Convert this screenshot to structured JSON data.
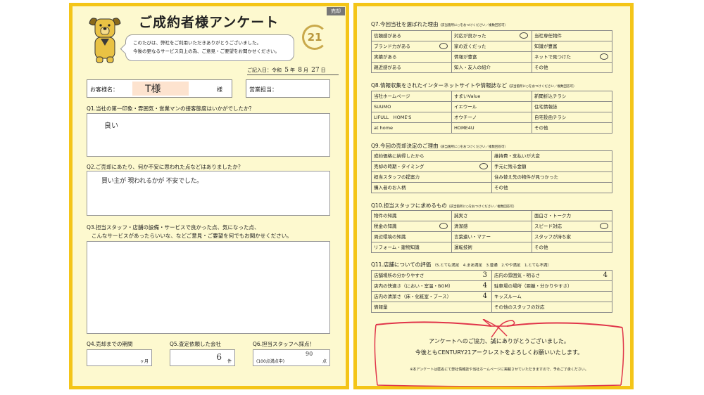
{
  "header": {
    "title": "ご成約者様アンケート",
    "intro_1": "このたびは、弊社をご利用いただきありがとうございました。",
    "intro_2": "今後の更なるサービス向上の為、ご意見・ご要望をお聞かせください。",
    "brand": "21",
    "tag": "売却"
  },
  "date": {
    "label": "ご記入日：令和",
    "year": "5",
    "month": "8",
    "day": "27",
    "y": "年",
    "m": "月",
    "d": "日"
  },
  "customer": {
    "label": "お客様名：",
    "name": "T様",
    "suffix": "様"
  },
  "staff": {
    "label": "営業担当："
  },
  "q1": {
    "label": "Q1.当社の第一印象・雰囲気・営業マンの接客態度はいかがでしたか？",
    "answer": "良い"
  },
  "q2": {
    "label": "Q2.ご売却にあたり、何か不安に思われた点などはありましたか？",
    "answer": "買い主が 現われるかが 不安でした。"
  },
  "q3": {
    "label_1": "Q3.担当スタッフ・店舗の設備・サービスで良かった点、気になった点、",
    "label_2": "こんなサービスがあったらいいな、などご意見・ご要望を何でもお聞かせください。",
    "answer": ""
  },
  "q4": {
    "label": "Q4.売却までの期間",
    "value": "",
    "unit": "ヶ月"
  },
  "q5": {
    "label": "Q5.査定依頼した会社",
    "value": "6",
    "unit": "件"
  },
  "q6": {
    "label": "Q6.担当スタッフへ採点！",
    "value": "90",
    "note": "(100点満点中)",
    "unit": "点"
  },
  "q7": {
    "label": "Q7.今回当社を選ばれた理由",
    "note": "（該当箇所に○をおつけください／複数回答可）",
    "rows": [
      [
        "信頼感がある",
        "対応が良かった",
        "当社専任物件"
      ],
      [
        "ブランド力がある",
        "家の近くだった",
        "知識が豊富"
      ],
      [
        "実績がある",
        "情報が豊富",
        "ネットで見つけた"
      ],
      [
        "親近感がある",
        "知人・友人の紹介",
        "その他"
      ]
    ],
    "marks": [
      [
        false,
        true,
        false
      ],
      [
        true,
        false,
        false
      ],
      [
        false,
        false,
        true
      ],
      [
        false,
        false,
        false
      ]
    ]
  },
  "q8": {
    "label": "Q8.情報収集をされたインターネットサイトや情報誌など",
    "note": "（該当箇所に○をおつけください／複数回答可）",
    "rows": [
      [
        "当社ホームページ",
        "すまいValue",
        "新聞折込チラシ"
      ],
      [
        "SUUMO",
        "イエウール",
        "住宅情報誌"
      ],
      [
        "LIFULL　HOME'S",
        "オウチーノ",
        "自宅投函チラシ"
      ],
      [
        "at home",
        "HOME4U",
        "その他"
      ]
    ]
  },
  "q9": {
    "label": "Q9.今回の売却決定のご理由",
    "note": "（該当箇所に○をおつけください／複数回答可）",
    "rows": [
      [
        "成約価格に納得したから",
        "維持費・支払いが大変"
      ],
      [
        "売却の時期・タイミング",
        "手元に残る金額"
      ],
      [
        "担当スタッフの提案力",
        "住み替え先の物件が見つかった"
      ],
      [
        "購入者のお人柄",
        "その他"
      ]
    ],
    "marks": [
      [
        false,
        false
      ],
      [
        true,
        false
      ],
      [
        false,
        false
      ],
      [
        false,
        false
      ]
    ]
  },
  "q10": {
    "label": "Q10.担当スタッフに求めるもの",
    "note": "（該当箇所に○をおつけください／複数回答可）",
    "rows": [
      [
        "物件の知識",
        "誠実さ",
        "面白さ・トーク力"
      ],
      [
        "税金の知識",
        "清潔感",
        "スピード対応"
      ],
      [
        "周辺環境の知識",
        "言葉遣い・マナー",
        "スタッフが持ち家"
      ],
      [
        "リフォーム・建物知識",
        "運転技術",
        "その他"
      ]
    ],
    "marks": [
      [
        false,
        false,
        false
      ],
      [
        true,
        false,
        true
      ],
      [
        false,
        false,
        false
      ],
      [
        false,
        false,
        false
      ]
    ]
  },
  "q11": {
    "label": "Q11.店舗についての評価",
    "scale": "（5.とても満足　4.まあ満足　3.普通　2.やや満足　1.とても不満）",
    "rows": [
      [
        "店舗場所の分かりやすさ",
        "3",
        "店内の雰囲気・明るさ",
        "4"
      ],
      [
        "店内の快適さ（におい・室温・BGM）",
        "4",
        "駐車場の場所（距離・分かりやすさ）",
        ""
      ],
      [
        "店内の清潔さ（床・化粧室・ブース）",
        "4",
        "キッズルーム",
        ""
      ],
      [
        "情報量",
        "",
        "その他のスタッフの対応",
        ""
      ]
    ]
  },
  "thanks": {
    "line_1": "アンケートへのご協力、誠にありがとうございました。",
    "line_2": "今後ともCENTURY21アークレストをよろしくお願いいたします。",
    "note": "※本アンケートは匿名にて弊社情報誌や当社ホームページに掲載させていただきますので、予めご了承ください。"
  },
  "colors": {
    "frame": "#f4c518",
    "paper": "#fdf9cf",
    "ribbon": "#e0354a",
    "brand": "#b8963c"
  }
}
